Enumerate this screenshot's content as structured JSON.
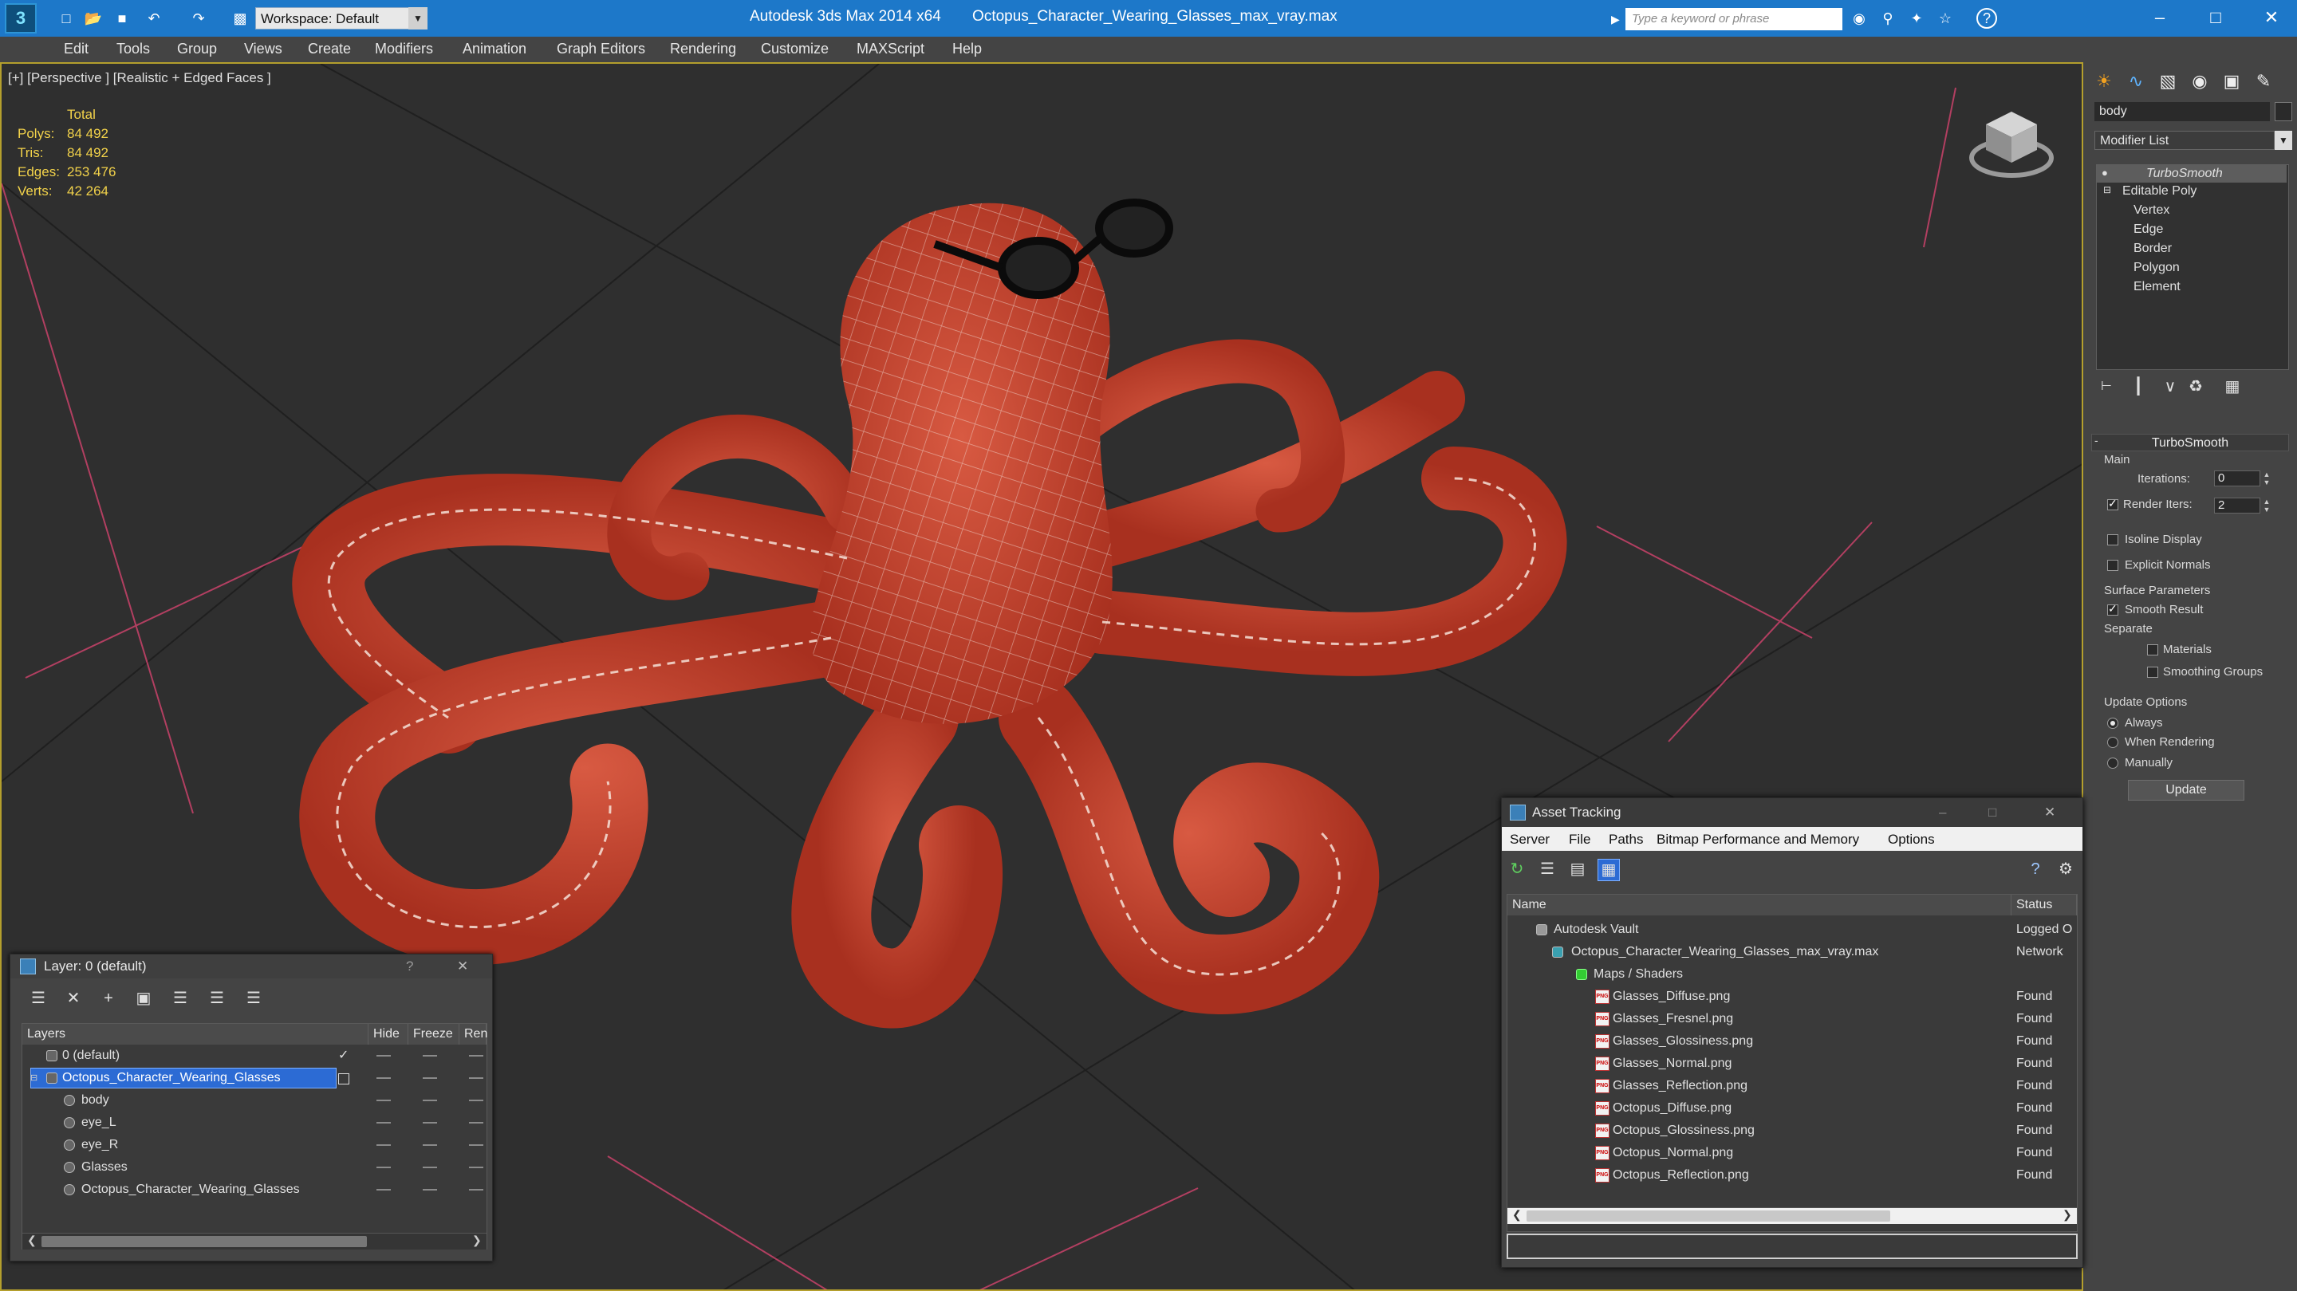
{
  "titlebar": {
    "app_title": "Autodesk 3ds Max  2014 x64",
    "file_name": "Octopus_Character_Wearing_Glasses_max_vray.max",
    "workspace": "Workspace: Default",
    "search_placeholder": "Type a keyword or phrase",
    "help_label": "?"
  },
  "menu": [
    "Edit",
    "Tools",
    "Group",
    "Views",
    "Create",
    "Modifiers",
    "Animation",
    "Graph Editors",
    "Rendering",
    "Customize",
    "MAXScript",
    "Help"
  ],
  "viewport": {
    "label": "[+] [Perspective ] [Realistic + Edged Faces ]",
    "stats_header": "Total",
    "stats": [
      {
        "label": "Polys:",
        "value": "84 492"
      },
      {
        "label": "Tris:",
        "value": "84 492"
      },
      {
        "label": "Edges:",
        "value": "253 476"
      },
      {
        "label": "Verts:",
        "value": "42 264"
      }
    ]
  },
  "command_panel": {
    "object_name": "body",
    "modifier_list": "Modifier List",
    "stack": [
      "TurboSmooth",
      "Editable Poly",
      "Vertex",
      "Edge",
      "Border",
      "Polygon",
      "Element"
    ],
    "rollout": "TurboSmooth",
    "main_group": "Main",
    "iterations_label": "Iterations:",
    "iterations_value": "0",
    "render_iters_label": "Render Iters:",
    "render_iters_value": "2",
    "isoline": "Isoline Display",
    "explicit_normals": "Explicit Normals",
    "surface_group": "Surface Parameters",
    "smooth_result": "Smooth Result",
    "separate": "Separate",
    "materials": "Materials",
    "smoothing_groups": "Smoothing Groups",
    "update_group": "Update Options",
    "always": "Always",
    "when_rendering": "When Rendering",
    "manually": "Manually",
    "update_button": "Update"
  },
  "layer_dialog": {
    "title": "Layer: 0 (default)",
    "help": "?",
    "columns": [
      "Layers",
      "Hide",
      "Freeze",
      "Ren"
    ],
    "rows": [
      "0 (default)",
      "Octopus_Character_Wearing_Glasses",
      "body",
      "eye_L",
      "eye_R",
      "Glasses",
      "Octopus_Character_Wearing_Glasses"
    ]
  },
  "asset_dialog": {
    "title": "Asset Tracking",
    "menu": [
      "Server",
      "File",
      "Paths",
      "Bitmap Performance and Memory",
      "Options"
    ],
    "col_name": "Name",
    "col_status": "Status",
    "rows": [
      {
        "name": "Autodesk Vault",
        "status": "Logged O"
      },
      {
        "name": "Octopus_Character_Wearing_Glasses_max_vray.max",
        "status": "Network"
      },
      {
        "name": "Maps / Shaders",
        "status": ""
      },
      {
        "name": "Glasses_Diffuse.png",
        "status": "Found"
      },
      {
        "name": "Glasses_Fresnel.png",
        "status": "Found"
      },
      {
        "name": "Glasses_Glossiness.png",
        "status": "Found"
      },
      {
        "name": "Glasses_Normal.png",
        "status": "Found"
      },
      {
        "name": "Glasses_Reflection.png",
        "status": "Found"
      },
      {
        "name": "Octopus_Diffuse.png",
        "status": "Found"
      },
      {
        "name": "Octopus_Glossiness.png",
        "status": "Found"
      },
      {
        "name": "Octopus_Normal.png",
        "status": "Found"
      },
      {
        "name": "Octopus_Reflection.png",
        "status": "Found"
      }
    ]
  },
  "colors": {
    "titlebar": "#1d78c9",
    "stats_text": "#f2d24a",
    "octopus_red": "#c8452f",
    "viewport_border": "#b49f2d",
    "selection": "#2c6bd4"
  }
}
